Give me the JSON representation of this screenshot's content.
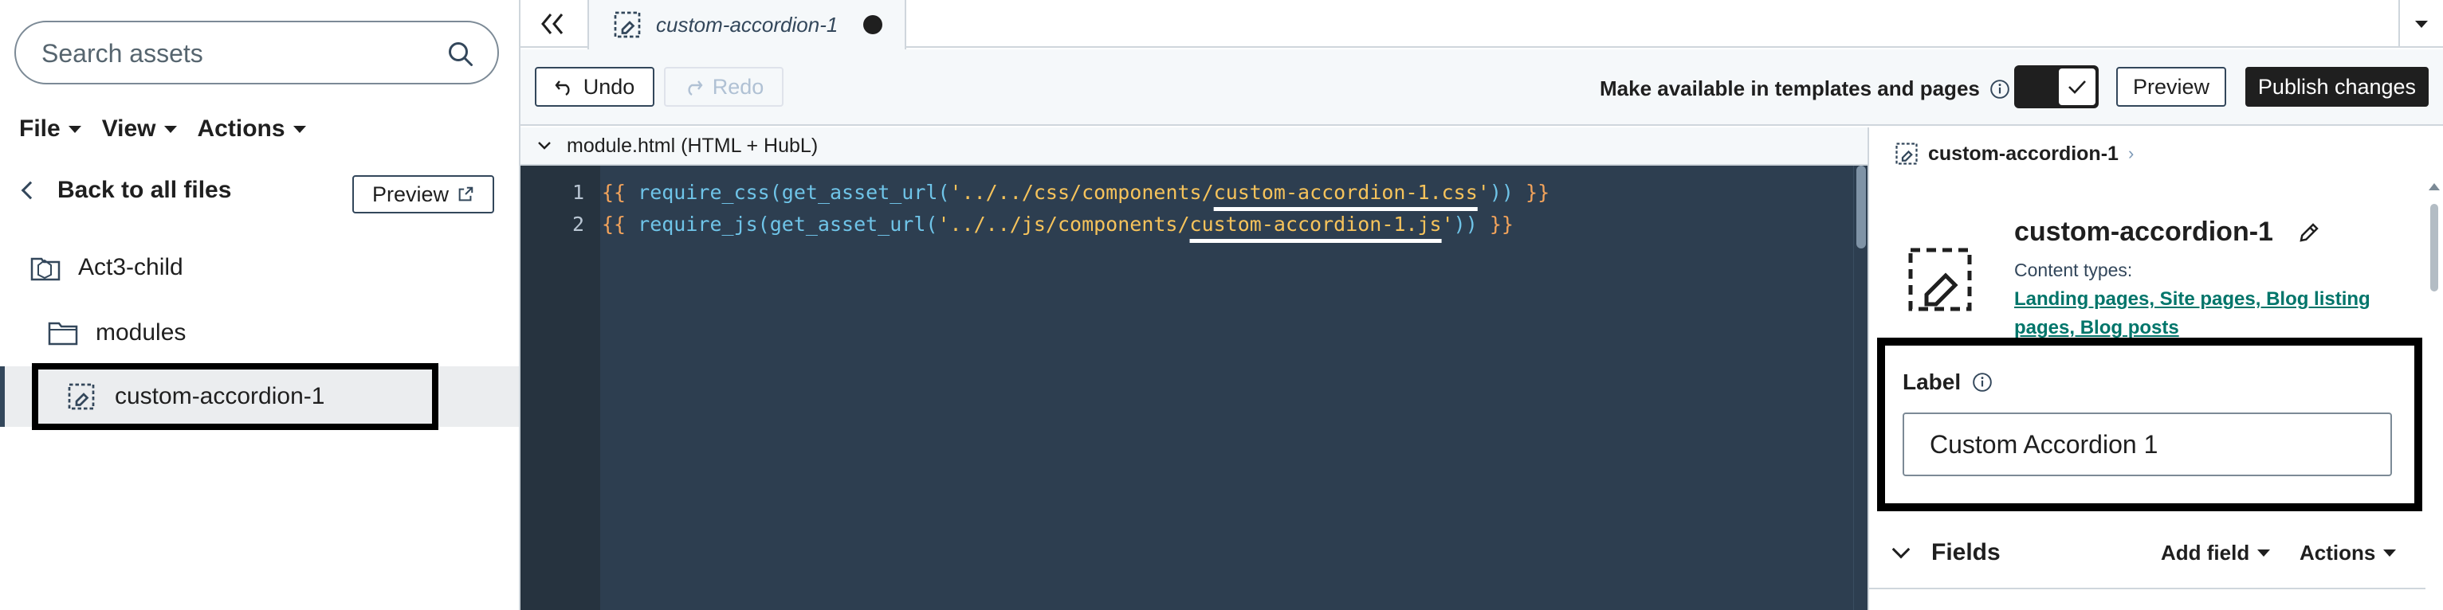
{
  "sidebar": {
    "search_placeholder": "Search assets",
    "menus": [
      "File",
      "View",
      "Actions"
    ],
    "back_label": "Back to all files",
    "preview_label": "Preview",
    "tree": [
      {
        "label": "Act3-child",
        "icon": "theme-folder-icon"
      },
      {
        "label": "modules",
        "icon": "folder-icon"
      },
      {
        "label": "custom-accordion-1",
        "icon": "module-icon",
        "selected": true
      }
    ]
  },
  "tabs": [
    {
      "label": "custom-accordion-1",
      "unsaved": true
    }
  ],
  "toolbar": {
    "undo_label": "Undo",
    "redo_label": "Redo",
    "availability_label": "Make available in templates and pages",
    "toggle_on": true,
    "preview_label": "Preview",
    "publish_label": "Publish changes"
  },
  "editor": {
    "file_header": "module.html (HTML + HubL)",
    "lines": [
      {
        "num": "1",
        "open": "{{ ",
        "fn": "require_css",
        "mid": "(get_asset_url(",
        "str_pre": "'../../css/components/",
        "str_hl": "custom-accordion-1.css",
        "str_post": "'",
        "close_paren": "))",
        "close": " }}"
      },
      {
        "num": "2",
        "open": "{{ ",
        "fn": "require_js",
        "mid": "(get_asset_url(",
        "str_pre": "'../../js/components/",
        "str_hl": "custom-accordion-1.js",
        "str_post": "'",
        "close_paren": "))",
        "close": " }}"
      }
    ]
  },
  "panel": {
    "breadcrumb": "custom-accordion-1",
    "module_title": "custom-accordion-1",
    "content_types_label": "Content types:",
    "content_types": "Landing pages, Site pages, Blog listing pages, Blog posts",
    "label_heading": "Label",
    "label_value": "Custom Accordion 1",
    "fields_title": "Fields",
    "add_field_label": "Add field",
    "actions_label": "Actions"
  },
  "colors": {
    "accent_dark": "#1f1f1f",
    "editor_bg": "#2d3e50",
    "link": "#00756a",
    "string": "#f6c35b",
    "function": "#6fc4e8",
    "brace": "#f2a35b"
  }
}
